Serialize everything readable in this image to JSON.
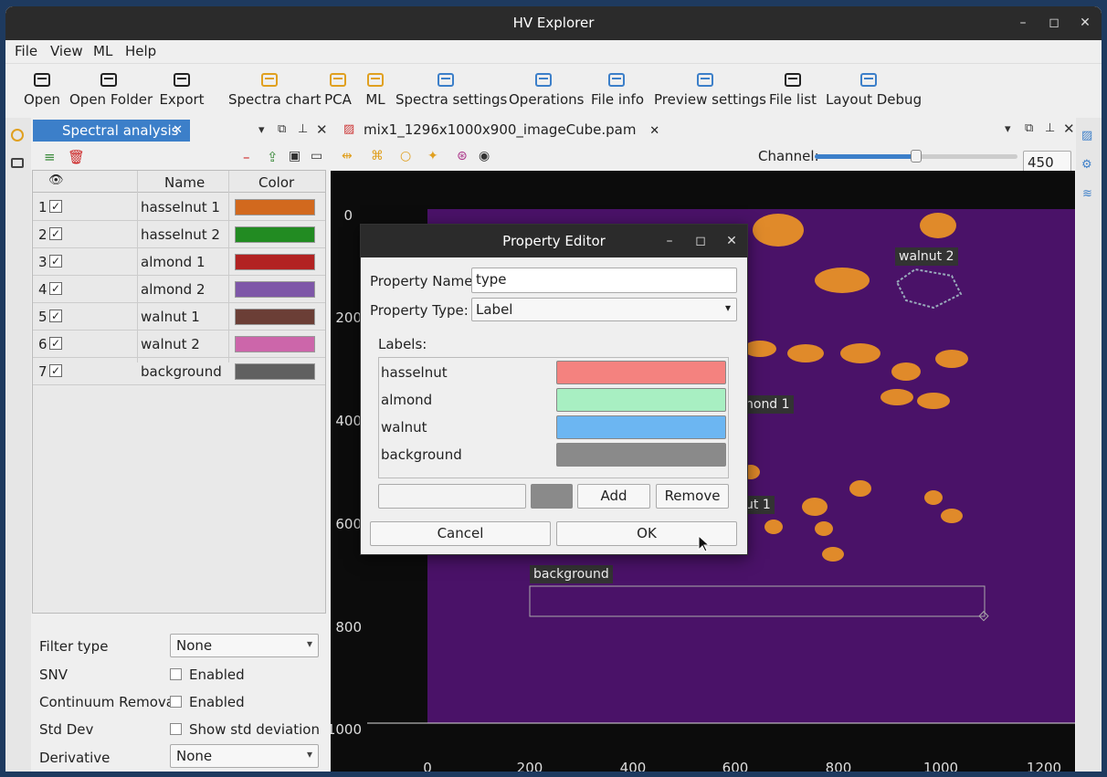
{
  "window": {
    "title": "HV Explorer"
  },
  "menu": [
    "File",
    "View",
    "ML",
    "Help"
  ],
  "toolbar": [
    {
      "label": "Open",
      "icon": "folder-icon",
      "color": "#222222"
    },
    {
      "label": "Open Folder",
      "icon": "folders-icon",
      "color": "#222222"
    },
    {
      "label": "Export",
      "icon": "export-icon",
      "color": "#222222"
    },
    {
      "label": "Spectra chart",
      "icon": "chart-icon",
      "color": "#e0a020"
    },
    {
      "label": "PCA",
      "icon": "gear-icon",
      "color": "#e0a020"
    },
    {
      "label": "ML",
      "icon": "brain-icon",
      "color": "#e0a020"
    },
    {
      "label": "Spectra settings",
      "icon": "table-icon",
      "color": "#3c7fc9"
    },
    {
      "label": "Operations",
      "icon": "chip-icon",
      "color": "#3c7fc9"
    },
    {
      "label": "File info",
      "icon": "database-icon",
      "color": "#3c7fc9"
    },
    {
      "label": "Preview settings",
      "icon": "image-icon",
      "color": "#3c7fc9"
    },
    {
      "label": "File list",
      "icon": "folders-icon",
      "color": "#222222"
    },
    {
      "label": "Layout Debug",
      "icon": "code-icon",
      "color": "#3c7fc9"
    }
  ],
  "spectral": {
    "tab": "Spectral analysis",
    "columns": {
      "name": "Name",
      "color": "Color"
    },
    "rows": [
      {
        "num": "1",
        "check": "✓",
        "name": "hasselnut 1",
        "color": "#d2691e"
      },
      {
        "num": "2",
        "check": "✓",
        "name": "hasselnut 2",
        "color": "#228b22"
      },
      {
        "num": "3",
        "check": "✓",
        "name": "almond 1",
        "color": "#b22222"
      },
      {
        "num": "4",
        "check": "✓",
        "name": "almond 2",
        "color": "#7e57a8"
      },
      {
        "num": "5",
        "check": "✓",
        "name": "walnut 1",
        "color": "#6b3e36"
      },
      {
        "num": "6",
        "check": "✓",
        "name": "walnut 2",
        "color": "#cc66aa"
      },
      {
        "num": "7",
        "check": "✓",
        "name": "background",
        "color": "#606060"
      }
    ],
    "filter_type_label": "Filter type",
    "filter_type_value": "None",
    "snv_label": "SNV",
    "snv_value": "Enabled",
    "cr_label": "Continuum Removal",
    "cr_value": "Enabled",
    "std_label": "Std Dev",
    "std_value": "Show std deviation",
    "deriv_label": "Derivative",
    "deriv_value": "None"
  },
  "viewer": {
    "tab": "mix1_1296x1000x900_imageCube.pam",
    "channel_label": "Channel:",
    "channel_value": "450",
    "channel_level": 0.5,
    "y_ticks": [
      "0",
      "200",
      "400",
      "600",
      "800",
      "1000"
    ],
    "x_ticks": [
      "0",
      "200",
      "400",
      "600",
      "800",
      "1000",
      "1200"
    ],
    "plot_labels": {
      "walnut2": "walnut 2",
      "almond1": "nond 1",
      "walnut1": "ut 1",
      "background": "background"
    }
  },
  "dialog": {
    "title": "Property Editor",
    "name_label": "Property Name:",
    "name_value": "type",
    "type_label": "Property Type:",
    "type_value": "Label",
    "labels_header": "Labels:",
    "labels": [
      {
        "name": "hasselnut",
        "color": "#f4827f"
      },
      {
        "name": "almond",
        "color": "#a8efc2"
      },
      {
        "name": "walnut",
        "color": "#6cb6f2"
      },
      {
        "name": "background",
        "color": "#8a8a8a"
      }
    ],
    "new_label_value": "",
    "new_color": "#8a8a8a",
    "add_label": "Add",
    "remove_label": "Remove",
    "cancel_label": "Cancel",
    "ok_label": "OK"
  }
}
